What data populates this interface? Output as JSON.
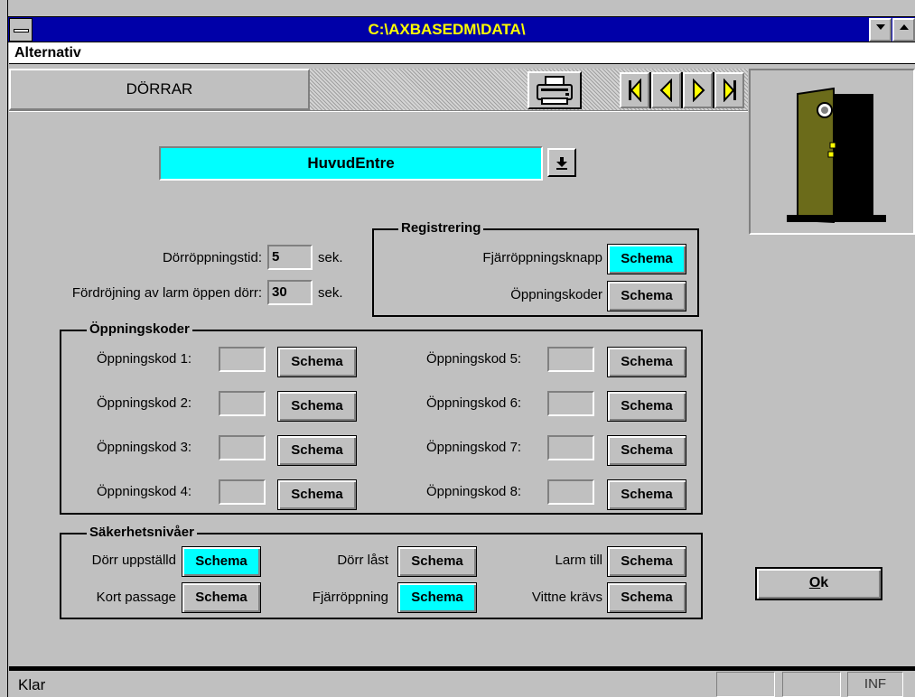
{
  "window": {
    "title": "C:\\AXBASEDM\\DATA\\"
  },
  "menu": {
    "items": [
      "Alternativ"
    ]
  },
  "tab": {
    "label": "DÖRRAR"
  },
  "door_select": {
    "value": "HuvudEntre"
  },
  "fields": {
    "door_open_time": {
      "label": "Dörröppningstid:",
      "value": "5",
      "unit": "sek."
    },
    "alarm_delay": {
      "label": "Fördröjning av larm öppen dörr:",
      "value": "30",
      "unit": "sek."
    }
  },
  "registrering": {
    "title": "Registrering",
    "rows": [
      {
        "label": "Fjärröppningsknapp",
        "button": "Schema",
        "active": true
      },
      {
        "label": "Öppningskoder",
        "button": "Schema",
        "active": false
      }
    ]
  },
  "oppningskoder": {
    "title": "Öppningskoder",
    "left": [
      {
        "label": "Öppningskod 1:",
        "button": "Schema"
      },
      {
        "label": "Öppningskod 2:",
        "button": "Schema"
      },
      {
        "label": "Öppningskod 3:",
        "button": "Schema"
      },
      {
        "label": "Öppningskod 4:",
        "button": "Schema"
      }
    ],
    "right": [
      {
        "label": "Öppningskod 5:",
        "button": "Schema"
      },
      {
        "label": "Öppningskod 6:",
        "button": "Schema"
      },
      {
        "label": "Öppningskod 7:",
        "button": "Schema"
      },
      {
        "label": "Öppningskod 8:",
        "button": "Schema"
      }
    ]
  },
  "sakerhetsnivaer": {
    "title": "Säkerhetsnivåer",
    "items": [
      {
        "label": "Dörr uppställd",
        "button": "Schema",
        "active": true
      },
      {
        "label": "Dörr låst",
        "button": "Schema",
        "active": false
      },
      {
        "label": "Larm till",
        "button": "Schema",
        "active": false
      },
      {
        "label": "Kort passage",
        "button": "Schema",
        "active": false
      },
      {
        "label": "Fjärröppning",
        "button": "Schema",
        "active": true
      },
      {
        "label": "Vittne krävs",
        "button": "Schema",
        "active": false
      }
    ]
  },
  "ok_button": {
    "accel": "O",
    "rest": "k"
  },
  "status": {
    "text": "Klar",
    "panel_inf": "INF"
  },
  "icons": [
    "system-menu-icon",
    "scroll-down-icon",
    "scroll-up-icon",
    "printer-icon",
    "first-record-icon",
    "previous-record-icon",
    "next-record-icon",
    "last-record-icon",
    "door-icon",
    "dropdown-arrow-icon"
  ],
  "colors": {
    "title_bar": "#0000a8",
    "title_text": "#ffff00",
    "active_button": "#00ffff",
    "combo_bg": "#00ffff",
    "face": "#c0c0c0",
    "door": "#6b6b1a"
  }
}
